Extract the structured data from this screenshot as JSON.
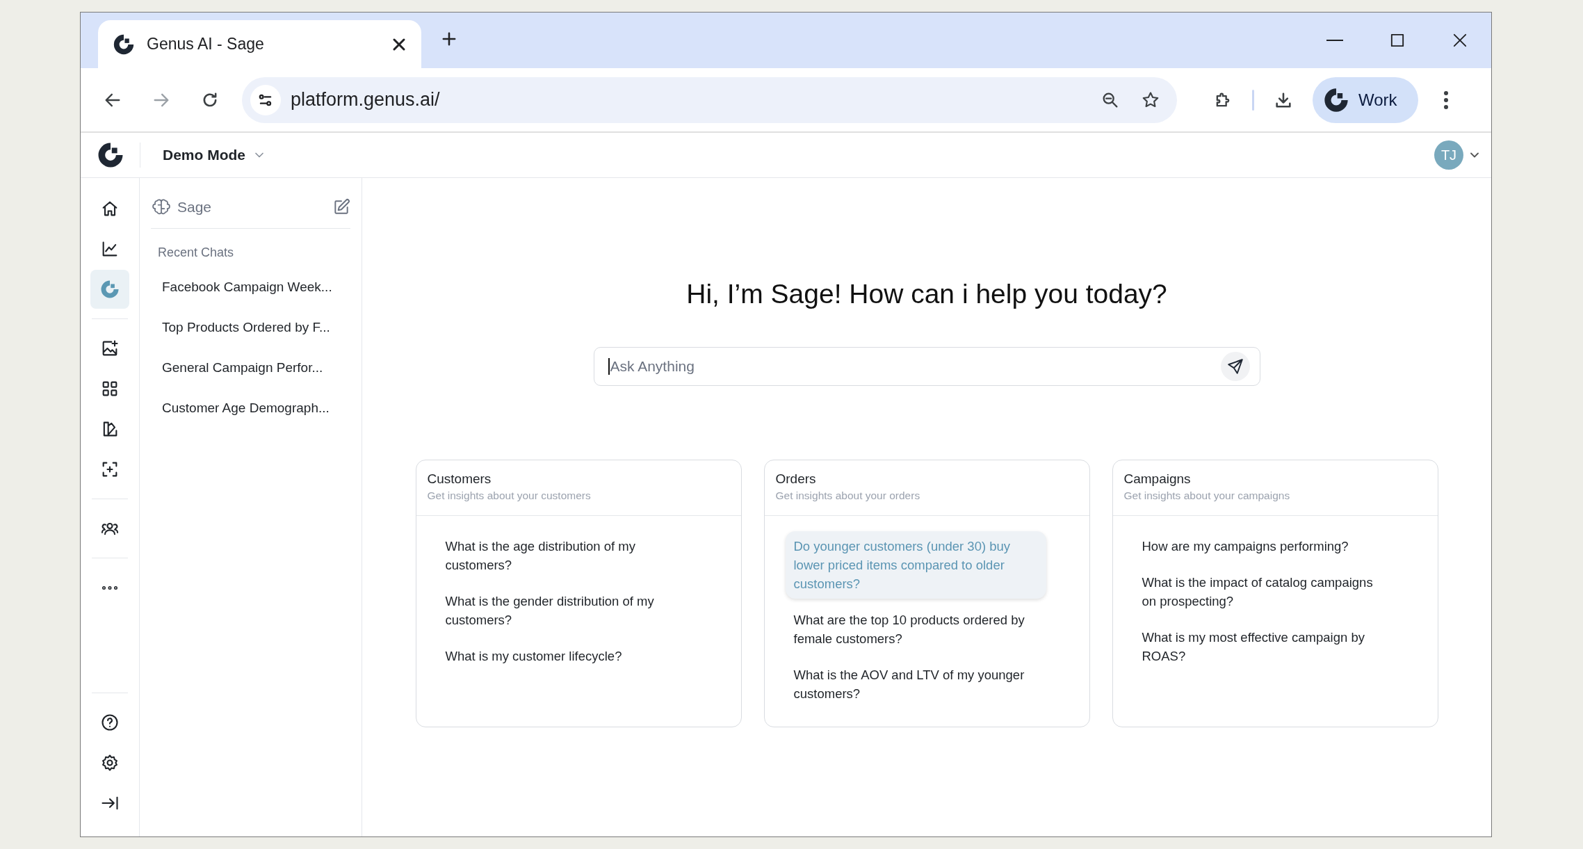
{
  "browser": {
    "tab": {
      "title": "Genus AI - Sage"
    },
    "address": "platform.genus.ai/",
    "profile": "Work"
  },
  "app_header": {
    "workspace": "Demo Mode",
    "avatar": "TJ"
  },
  "rail": {
    "groups": [
      {
        "items": [
          {
            "selected": false
          },
          {
            "selected": false
          },
          {
            "selected": true
          }
        ]
      },
      {
        "items": [
          {
            "selected": false
          },
          {
            "selected": false
          },
          {
            "selected": false
          },
          {
            "selected": false
          }
        ]
      },
      {
        "items": [
          {
            "selected": false
          }
        ]
      },
      {
        "items": [
          {
            "selected": false
          }
        ]
      }
    ],
    "bottom": [
      {
        "selected": false
      },
      {
        "selected": false
      },
      {
        "selected": false
      }
    ]
  },
  "sidebar": {
    "title": "Sage",
    "section": "Recent Chats",
    "chats": [
      "Facebook Campaign Week...",
      "Top Products Ordered by F...",
      "General Campaign Perfor...",
      "Customer Age Demograph..."
    ]
  },
  "main": {
    "greeting": "Hi, I’m Sage! How can i help you today?",
    "input": {
      "placeholder": "Ask Anything"
    },
    "cards": [
      {
        "title": "Customers",
        "subtitle": "Get insights about your customers",
        "questions": [
          {
            "text": "What is the age distribution of my customers?",
            "selected": false
          },
          {
            "text": "What is the gender distribution of my customers?",
            "selected": false
          },
          {
            "text": "What is my customer lifecycle?",
            "selected": false
          }
        ]
      },
      {
        "title": "Orders",
        "subtitle": "Get insights about your orders",
        "questions": [
          {
            "text": "Do younger customers (under 30) buy lower priced items compared to older customers?",
            "selected": true
          },
          {
            "text": "What are the top 10 products ordered by female customers?",
            "selected": false
          },
          {
            "text": "What is the AOV and LTV of my younger customers?",
            "selected": false
          }
        ]
      },
      {
        "title": "Campaigns",
        "subtitle": "Get insights about your campaigns",
        "questions": [
          {
            "text": "How are my campaigns performing?",
            "selected": false
          },
          {
            "text": "What is the impact of catalog campaigns on prospecting?",
            "selected": false
          },
          {
            "text": "What is my most effective campaign by ROAS?",
            "selected": false
          }
        ]
      }
    ]
  }
}
